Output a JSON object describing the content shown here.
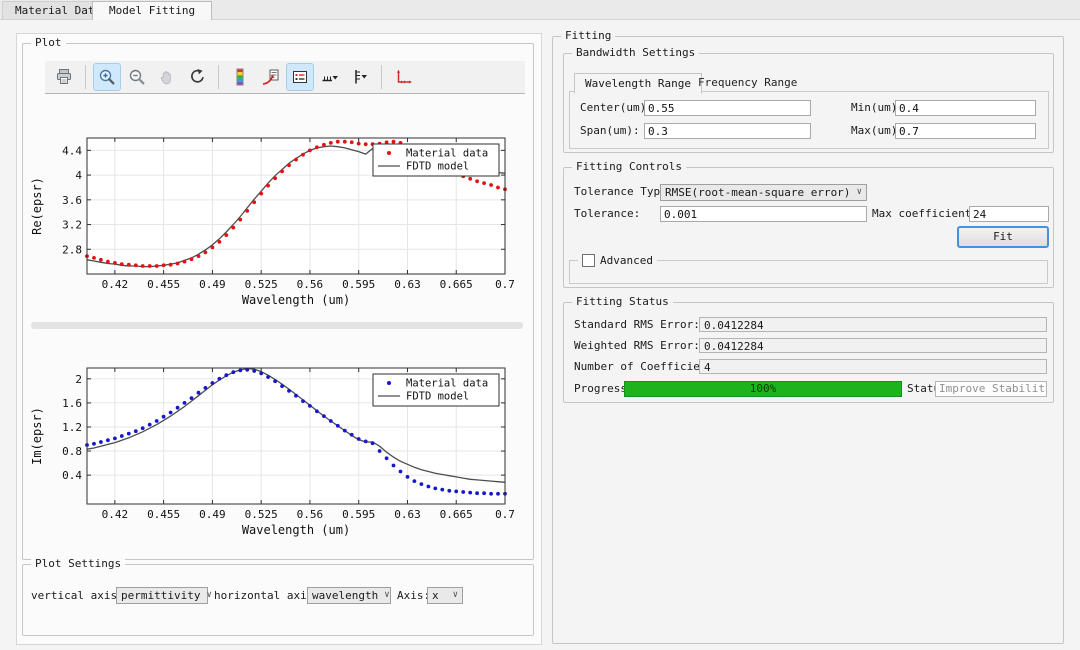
{
  "tabs": [
    {
      "label": "Material Data",
      "active": false
    },
    {
      "label": "Model Fitting",
      "active": true
    }
  ],
  "plot_panel": {
    "group_title": "Plot",
    "toolbar_buttons": [
      "print",
      "zoom-in",
      "zoom-out",
      "pan",
      "reset-view",
      "colormap",
      "data-cursor",
      "legend-toggle",
      "x-axis-menu",
      "y-axis-menu",
      "axes-autoscale"
    ],
    "toolbar_active": [
      "zoom-in",
      "legend-toggle"
    ],
    "toolbar_disabled": [
      "pan"
    ]
  },
  "plot_settings": {
    "group_title": "Plot Settings",
    "vertical_axis_label": "vertical axis:",
    "vertical_axis_value": "permittivity",
    "horizontal_axis_label": "horizontal axis:",
    "horizontal_axis_value": "wavelength",
    "axis_label": "Axis:",
    "axis_value": "x"
  },
  "fitting": {
    "group_title": "Fitting",
    "bandwidth": {
      "group_title": "Bandwidth Settings",
      "tabs": [
        "Wavelength Range",
        "Frequency Range"
      ],
      "center_label": "Center(um):",
      "center_value": "0.55",
      "span_label": "Span(um):",
      "span_value": "0.3",
      "min_label": "Min(um):",
      "min_value": "0.4",
      "max_label": "Max(um):",
      "max_value": "0.7"
    },
    "controls": {
      "group_title": "Fitting Controls",
      "tolerance_type_label": "Tolerance Type:",
      "tolerance_type_value": "RMSE(root-mean-square error)",
      "tolerance_label": "Tolerance:",
      "tolerance_value": "0.001",
      "max_coeff_label": "Max coefficients:",
      "max_coeff_value": "24",
      "fit_label": "Fit",
      "advanced_label": "Advanced",
      "advanced_checked": false
    },
    "status": {
      "group_title": "Fitting Status",
      "rows": [
        {
          "label": "Standard RMS Error:",
          "value": "0.0412284"
        },
        {
          "label": "Weighted RMS Error:",
          "value": "0.0412284"
        },
        {
          "label": "Number of Coefficients:",
          "value": "4"
        }
      ],
      "progress_label": "Progress:",
      "progress_text": "100%",
      "progress_value": 100,
      "progress_color": "#1db31d",
      "status_label": "Status:",
      "status_value": "Improve Stability"
    }
  },
  "chart_data": [
    {
      "type": "scatter",
      "xlabel": "Wavelength (um)",
      "ylabel": "Re(epsr)",
      "xlim": [
        0.4,
        0.7
      ],
      "ylim": [
        2.4,
        4.6
      ],
      "xticks": [
        0.42,
        0.455,
        0.49,
        0.525,
        0.56,
        0.595,
        0.63,
        0.665,
        0.7
      ],
      "xtick_labels": [
        "0.42",
        "0.455",
        "0.49",
        "0.525",
        "0.56",
        "0.595",
        "0.63",
        "0.665",
        "0.7"
      ],
      "yticks": [
        2.8,
        3.2,
        3.6,
        4,
        4.4
      ],
      "ytick_labels": [
        "2.8",
        "3.2",
        "3.6",
        "4",
        "4.4"
      ],
      "grid": true,
      "legend_position": "top-right",
      "x": [
        0.4,
        0.405,
        0.41,
        0.415,
        0.42,
        0.425,
        0.43,
        0.435,
        0.44,
        0.445,
        0.45,
        0.455,
        0.46,
        0.465,
        0.47,
        0.475,
        0.48,
        0.485,
        0.49,
        0.495,
        0.5,
        0.505,
        0.51,
        0.515,
        0.52,
        0.525,
        0.53,
        0.535,
        0.54,
        0.545,
        0.55,
        0.555,
        0.56,
        0.565,
        0.57,
        0.575,
        0.58,
        0.585,
        0.59,
        0.595,
        0.6,
        0.605,
        0.61,
        0.615,
        0.62,
        0.625,
        0.63,
        0.635,
        0.64,
        0.645,
        0.65,
        0.655,
        0.66,
        0.665,
        0.67,
        0.675,
        0.68,
        0.685,
        0.69,
        0.695,
        0.7
      ],
      "series": [
        {
          "name": "Material data",
          "style": "scatter",
          "color": "#e41212",
          "values": [
            2.69,
            2.66,
            2.63,
            2.6,
            2.58,
            2.56,
            2.55,
            2.54,
            2.53,
            2.53,
            2.53,
            2.54,
            2.55,
            2.57,
            2.6,
            2.64,
            2.69,
            2.75,
            2.83,
            2.92,
            3.03,
            3.15,
            3.28,
            3.42,
            3.56,
            3.7,
            3.83,
            3.95,
            4.06,
            4.16,
            4.25,
            4.33,
            4.4,
            4.45,
            4.49,
            4.52,
            4.54,
            4.54,
            4.53,
            4.51,
            4.5,
            4.5,
            4.51,
            4.53,
            4.54,
            4.52,
            4.48,
            4.41,
            4.33,
            4.26,
            4.19,
            4.13,
            4.07,
            4.02,
            3.98,
            3.94,
            3.9,
            3.87,
            3.84,
            3.8,
            3.77
          ]
        },
        {
          "name": "FDTD model",
          "style": "line",
          "color": "#4d4d4d",
          "values": [
            2.63,
            2.61,
            2.59,
            2.57,
            2.56,
            2.54,
            2.53,
            2.53,
            2.52,
            2.52,
            2.53,
            2.54,
            2.56,
            2.58,
            2.62,
            2.66,
            2.72,
            2.79,
            2.87,
            2.97,
            3.08,
            3.2,
            3.33,
            3.47,
            3.61,
            3.74,
            3.87,
            3.99,
            4.09,
            4.19,
            4.27,
            4.34,
            4.4,
            4.44,
            4.46,
            4.47,
            4.46,
            4.44,
            4.41,
            4.38,
            4.34,
            4.43,
            4.45,
            4.44,
            4.42,
            4.4,
            4.37,
            4.33,
            4.29,
            4.25,
            4.21,
            4.18,
            4.15,
            4.12,
            4.1,
            4.08,
            4.07,
            4.06,
            4.05,
            4.04,
            4.03
          ]
        }
      ]
    },
    {
      "type": "scatter",
      "xlabel": "Wavelength (um)",
      "ylabel": "Im(epsr)",
      "xlim": [
        0.4,
        0.7
      ],
      "ylim": [
        -0.08,
        2.18
      ],
      "xticks": [
        0.42,
        0.455,
        0.49,
        0.525,
        0.56,
        0.595,
        0.63,
        0.665,
        0.7
      ],
      "xtick_labels": [
        "0.42",
        "0.455",
        "0.49",
        "0.525",
        "0.56",
        "0.595",
        "0.63",
        "0.665",
        "0.7"
      ],
      "yticks": [
        0.4,
        0.8,
        1.2,
        1.6,
        2
      ],
      "ytick_labels": [
        "0.4",
        "0.8",
        "1.2",
        "1.6",
        "2"
      ],
      "grid": true,
      "legend_position": "top-right",
      "x": [
        0.4,
        0.405,
        0.41,
        0.415,
        0.42,
        0.425,
        0.43,
        0.435,
        0.44,
        0.445,
        0.45,
        0.455,
        0.46,
        0.465,
        0.47,
        0.475,
        0.48,
        0.485,
        0.49,
        0.495,
        0.5,
        0.505,
        0.51,
        0.515,
        0.52,
        0.525,
        0.53,
        0.535,
        0.54,
        0.545,
        0.55,
        0.555,
        0.56,
        0.565,
        0.57,
        0.575,
        0.58,
        0.585,
        0.59,
        0.595,
        0.6,
        0.605,
        0.61,
        0.615,
        0.62,
        0.625,
        0.63,
        0.635,
        0.64,
        0.645,
        0.65,
        0.655,
        0.66,
        0.665,
        0.67,
        0.675,
        0.68,
        0.685,
        0.69,
        0.695,
        0.7
      ],
      "series": [
        {
          "name": "Material data",
          "style": "scatter",
          "color": "#1717cf",
          "values": [
            0.9,
            0.92,
            0.95,
            0.98,
            1.01,
            1.05,
            1.09,
            1.13,
            1.18,
            1.24,
            1.3,
            1.37,
            1.44,
            1.52,
            1.6,
            1.68,
            1.77,
            1.85,
            1.93,
            2.0,
            2.06,
            2.11,
            2.14,
            2.15,
            2.13,
            2.09,
            2.03,
            1.96,
            1.88,
            1.8,
            1.72,
            1.63,
            1.55,
            1.46,
            1.38,
            1.3,
            1.22,
            1.14,
            1.07,
            1.0,
            0.96,
            0.93,
            0.8,
            0.68,
            0.56,
            0.46,
            0.37,
            0.3,
            0.25,
            0.21,
            0.18,
            0.16,
            0.14,
            0.13,
            0.12,
            0.11,
            0.1,
            0.1,
            0.09,
            0.09,
            0.09
          ]
        },
        {
          "name": "FDTD model",
          "style": "line",
          "color": "#4d4d4d",
          "values": [
            0.83,
            0.85,
            0.88,
            0.91,
            0.94,
            0.98,
            1.02,
            1.07,
            1.12,
            1.18,
            1.24,
            1.31,
            1.38,
            1.46,
            1.54,
            1.63,
            1.72,
            1.81,
            1.9,
            1.98,
            2.05,
            2.11,
            2.15,
            2.17,
            2.16,
            2.12,
            2.06,
            1.99,
            1.91,
            1.83,
            1.74,
            1.65,
            1.56,
            1.47,
            1.38,
            1.3,
            1.22,
            1.14,
            1.06,
            0.99,
            0.95,
            0.95,
            0.88,
            0.78,
            0.7,
            0.63,
            0.58,
            0.53,
            0.49,
            0.46,
            0.43,
            0.41,
            0.39,
            0.37,
            0.35,
            0.33,
            0.32,
            0.31,
            0.3,
            0.29,
            0.28
          ]
        }
      ]
    }
  ]
}
